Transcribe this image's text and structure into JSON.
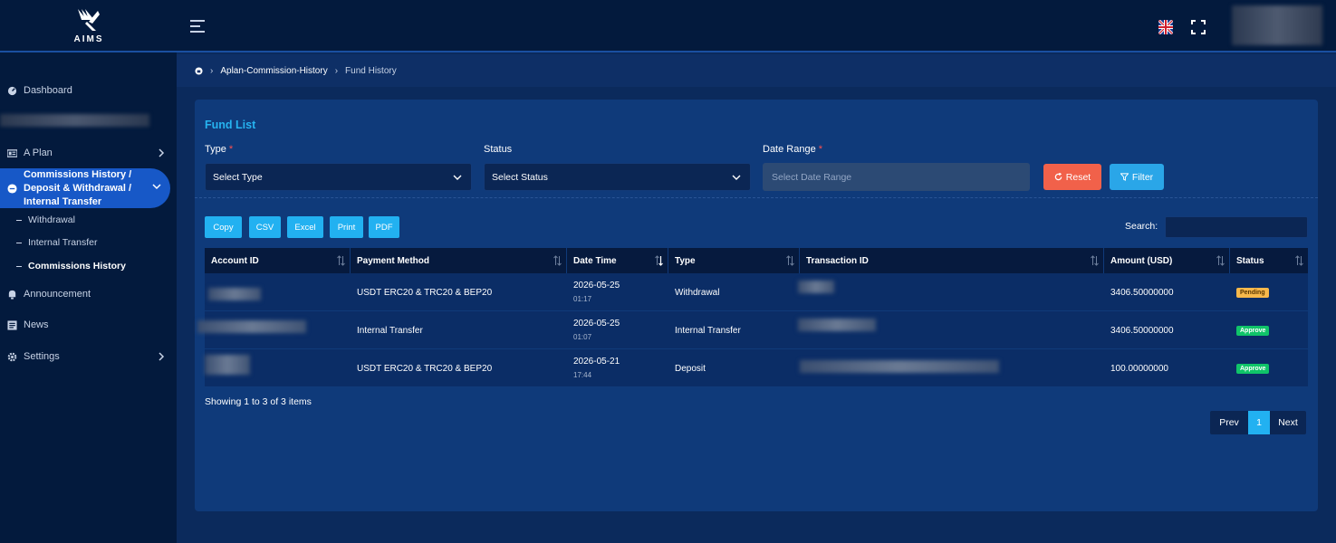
{
  "brand": {
    "logo_text": "AIMS"
  },
  "sidebar": {
    "items": [
      {
        "label": "Dashboard",
        "icon": "dashboard-icon"
      },
      {
        "label": "A Plan",
        "icon": "plan-icon"
      },
      {
        "label": "Commissions History / Deposit & Withdrawal / Internal Transfer",
        "icon": "history-icon"
      },
      {
        "label": "Announcement",
        "icon": "bell-icon"
      },
      {
        "label": "News",
        "icon": "news-icon"
      },
      {
        "label": "Settings",
        "icon": "gear-icon"
      }
    ],
    "sub_items": [
      {
        "label": "Withdrawal"
      },
      {
        "label": "Internal Transfer"
      },
      {
        "label": "Commissions History"
      }
    ]
  },
  "breadcrumb": {
    "parent": "Aplan-Commission-History",
    "current": "Fund History"
  },
  "card": {
    "title": "Fund List",
    "filters": {
      "type_label": "Type",
      "type_value": "Select Type",
      "status_label": "Status",
      "status_value": "Select Status",
      "date_label": "Date Range",
      "date_placeholder": "Select Date Range",
      "required_mark": "*",
      "reset_label": "Reset",
      "filter_label": "Filter"
    },
    "export_buttons": [
      "Copy",
      "CSV",
      "Excel",
      "Print",
      "PDF"
    ],
    "search_label": "Search:",
    "table": {
      "columns": [
        "Account ID",
        "Payment Method",
        "Date Time",
        "Type",
        "Transaction ID",
        "Amount (USD)",
        "Status"
      ],
      "rows": [
        {
          "payment_method": "USDT ERC20 & TRC20 & BEP20",
          "date": "2026-05-25",
          "time": "01:17",
          "type": "Withdrawal",
          "amount": "3406.50000000",
          "status": "Pending"
        },
        {
          "payment_method": "Internal Transfer",
          "date": "2026-05-25",
          "time": "01:07",
          "type": "Internal Transfer",
          "amount": "3406.50000000",
          "status": "Approve"
        },
        {
          "payment_method": "USDT ERC20 & TRC20 & BEP20",
          "date": "2026-05-21",
          "time": "17:44",
          "type": "Deposit",
          "amount": "100.00000000",
          "status": "Approve"
        }
      ]
    },
    "showing": "Showing 1 to 3 of 3 items",
    "pagination": {
      "prev": "Prev",
      "page": "1",
      "next": "Next"
    }
  },
  "colors": {
    "accent": "#22b1f1",
    "active_nav": "#1758c7",
    "reset": "#f1614a",
    "pending": "#f7b84b",
    "approve": "#10c469"
  }
}
